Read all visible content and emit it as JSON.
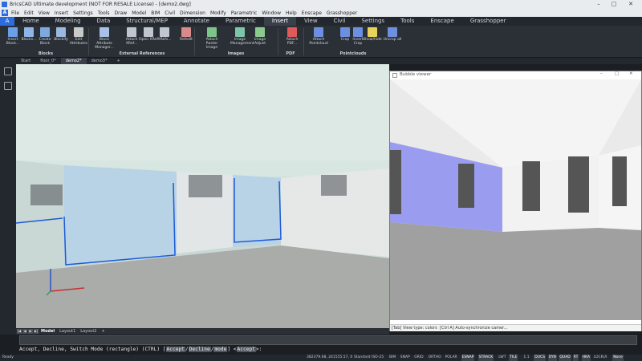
{
  "window": {
    "title": "BricsCAD Ultimate development (NOT FOR RESALE License) - [demo2.dwg]",
    "minimize": "–",
    "maximize": "□",
    "close": "✕"
  },
  "menu": {
    "items": [
      "File",
      "Edit",
      "View",
      "Insert",
      "Settings",
      "Tools",
      "Draw",
      "Model",
      "BIM",
      "Civil",
      "Dimension",
      "Modify",
      "Parametric",
      "Window",
      "Help",
      "Enscape",
      "Grasshopper"
    ]
  },
  "ribbon_tabs": [
    "Home",
    "Modeling",
    "Data",
    "Structural/MEP",
    "Annotate",
    "Parametric",
    "Insert",
    "View",
    "Civil",
    "Settings",
    "Tools",
    "Enscape",
    "Grasshopper"
  ],
  "ribbon_tab_home_letter": "A",
  "ribbon_active_tab": "Insert",
  "ribbon": {
    "buttons": [
      {
        "label": "Insert Block...",
        "icon": "insert-block-icon",
        "color": "#6aa0e8"
      },
      {
        "label": "Blocks...",
        "icon": "blocks-icon",
        "color": "#8fb4e6"
      },
      {
        "label": "Create Block",
        "icon": "create-block-icon",
        "color": "#7ea9e0"
      },
      {
        "label": "Blockify",
        "icon": "blockify-icon",
        "color": "#9bb9df"
      },
      {
        "label": "Edit Attributes",
        "icon": "edit-attributes-icon",
        "color": "#c9c9c9"
      },
      {
        "label": "Block Attribute Manager...",
        "icon": "attribute-manager-icon",
        "color": "#a9c1e6"
      },
      {
        "label": "Attach XRef...",
        "icon": "attach-xref-icon",
        "color": "#bfc6d0"
      },
      {
        "label": "Open XRef",
        "icon": "open-xref-icon",
        "color": "#bfc6d0"
      },
      {
        "label": "XRefs...",
        "icon": "xrefs-icon",
        "color": "#bfc6d0"
      },
      {
        "label": "Refedit",
        "icon": "refedit-icon",
        "color": "#d98a8a"
      },
      {
        "label": "Attach Raster Image",
        "icon": "raster-image-icon",
        "color": "#7ec48a"
      },
      {
        "label": "Image Management",
        "icon": "image-management-icon",
        "color": "#7ec4a8"
      },
      {
        "label": "Image Adjust",
        "icon": "image-adjust-icon",
        "color": "#8cc98f"
      },
      {
        "label": "Attach PDF...",
        "icon": "attach-pdf-icon",
        "color": "#e05a5a"
      },
      {
        "label": "Attach Pointcloud",
        "icon": "attach-pointcloud-icon",
        "color": "#6d8fe0"
      },
      {
        "label": "Crop",
        "icon": "crop-icon",
        "color": "#6d8fe0"
      },
      {
        "label": "Invert Crop",
        "icon": "invert-crop-icon",
        "color": "#6d8fe0"
      },
      {
        "label": "Show/hide",
        "icon": "show-hide-icon",
        "color": "#e8d25a"
      },
      {
        "label": "Uncrop all",
        "icon": "uncrop-all-icon",
        "color": "#6d8fe0"
      }
    ],
    "groups": [
      "Blocks",
      "External References",
      "Images",
      "PDF",
      "Pointclouds"
    ]
  },
  "doc_tabs": {
    "items": [
      "Start",
      "floor_0*",
      "demo2*",
      "demo3*"
    ],
    "add": "+",
    "active": "demo2*"
  },
  "bubble_viewer": {
    "title": "Bubble viewer",
    "status_left": "[Tab] View type: colors",
    "status_right": "[Ctrl A] Auto-synchronize camer..."
  },
  "model_tabs": {
    "items": [
      "Model",
      "Layout1",
      "Layout2"
    ],
    "add": "+"
  },
  "command": {
    "line_prefix": "Accept, Decline, Switch Mode (rectangle) (CTRL) [",
    "opt1": "Accept",
    "sep1": "/",
    "opt2": "Decline",
    "sep2": "/",
    "opt3": "mode",
    "mid": "] <",
    "default": "Accept",
    "end": ">:"
  },
  "status": {
    "left": "Ready",
    "coords": "382379.68, 241555.57, 0",
    "style": "Standard",
    "dimstyle": "ISO-25",
    "toggles": [
      "BIM",
      "SNAP",
      "GRID",
      "ORTHO",
      "POLAR",
      "ESNAP",
      "STRACK",
      "LWT",
      "TILE",
      "1:1",
      "DUCS",
      "DYN",
      "QUAD",
      "RT",
      "HKA",
      "LOCKUI",
      "None"
    ]
  },
  "colors": {
    "accent": "#2d6cdf",
    "boundary": "#1e5bd6",
    "highlight_wall": "#9a9cf0"
  }
}
